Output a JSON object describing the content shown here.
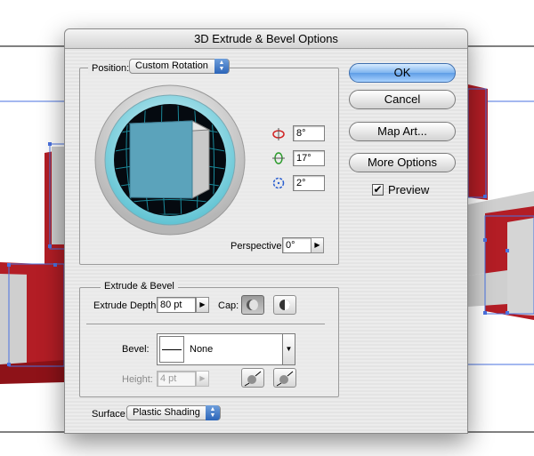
{
  "dialog": {
    "title": "3D Extrude & Bevel Options"
  },
  "position": {
    "label": "Position:",
    "value": "Custom Rotation",
    "x_rotation": "8°",
    "y_rotation": "17°",
    "z_rotation": "2°",
    "perspective_label": "Perspective:",
    "perspective_value": "0°"
  },
  "extrude_bevel": {
    "legend": "Extrude & Bevel",
    "depth_label": "Extrude Depth:",
    "depth_value": "80 pt",
    "cap_label": "Cap:",
    "bevel_label": "Bevel:",
    "bevel_value": "None",
    "height_label": "Height:",
    "height_value": "4 pt"
  },
  "surface": {
    "label": "Surface:",
    "value": "Plastic Shading"
  },
  "buttons": {
    "ok": "OK",
    "cancel": "Cancel",
    "map_art": "Map Art...",
    "more_options": "More Options"
  },
  "preview": {
    "label": "Preview",
    "checked": true
  },
  "colors": {
    "cube_front": "#5ba3bb",
    "extrusion_red": "#b31d25",
    "selection_blue": "#4a72e0"
  }
}
